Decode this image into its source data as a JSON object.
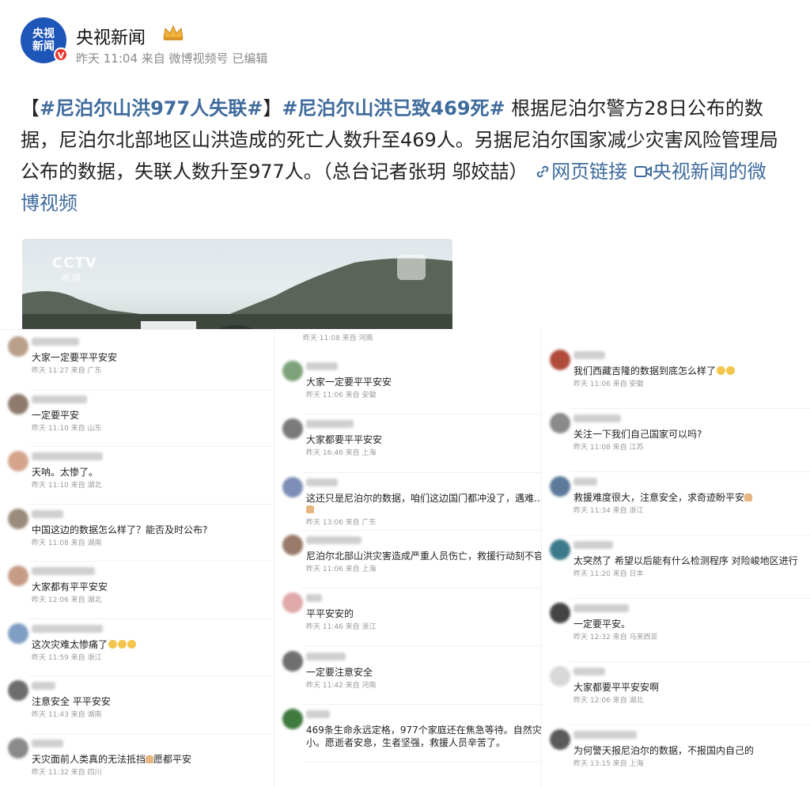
{
  "post": {
    "author": "央视新闻",
    "avatar_text_1": "央视",
    "avatar_text_2": "新闻",
    "verified_icon": "V",
    "time": "昨天 11:04",
    "source": "来自 微博视频号",
    "edited": "已编辑",
    "bracket_open": "【",
    "tag1": "#尼泊尔山洪977人失联#",
    "bracket_close": "】",
    "tag2": "#尼泊尔山洪已致469死#",
    "body": " 根据尼泊尔警方28日公布的数据，尼泊尔北部地区山洪造成的死亡人数升至469人。另据尼泊尔国家减少灾害风险管理局公布的数据，失联人数升至977人。（总台记者张玥 邬姣喆）",
    "link_web": "网页链接",
    "link_video": "央视新闻的微博视频",
    "icons": {
      "web_link": "link-icon",
      "video": "video-icon",
      "badge": "crown-badge-icon"
    }
  },
  "video": {
    "watermark": "CCTV",
    "watermark_sub": "新闻"
  },
  "columns": [
    {
      "top_time": "",
      "comments": [
        {
          "text": "大家一定要平平安安",
          "time": "昨天 11:27 来自 广东",
          "avatar": "#b8a08a"
        },
        {
          "text": "一定要平安",
          "time": "昨天 11:10 来自 山东",
          "avatar": "#8f7b6e"
        },
        {
          "text": "天呐。太惨了。",
          "time": "昨天 11:10 来自 湖北",
          "avatar": "#d4a48c"
        },
        {
          "text": "中国这边的数据怎么样了？能否及时公布?",
          "time": "昨天 11:08 来自 湖南",
          "avatar": "#9a8c7c"
        },
        {
          "text": "大家都有平平安安",
          "time": "昨天 12:06 来自 湖北",
          "avatar": "#c59c86"
        },
        {
          "text": "这次灾难太惨痛了",
          "time": "昨天 11:59 来自 浙江",
          "avatar": "#7f9ec4",
          "emoji": 3
        },
        {
          "text": "注意安全 平平安安",
          "time": "昨天 11:43 来自 湖南",
          "avatar": "#6d6d6d"
        },
        {
          "text": "天灾面前人类真的无法抵挡",
          "text_after": "愿都平安",
          "pray": true,
          "time": "昨天 11:32 来自 四川",
          "avatar": "#8a8a8a"
        }
      ]
    },
    {
      "top_time": "昨天 11:08 来自 河南",
      "comments": [
        {
          "text": "大家一定要平平安安",
          "time": "昨天 11:06 来自 安徽",
          "avatar": "#7ea37a"
        },
        {
          "text": "大家都要平平安安",
          "time": "昨天 16:46 来自 上海",
          "avatar": "#7a7a7a"
        },
        {
          "text": "这还只是尼泊尔的数据，咱们这边国门都冲没了，遇难...",
          "text2": "",
          "pray_line": true,
          "time": "昨天 13:06 来自 广东",
          "avatar": "#7d8fb8"
        },
        {
          "text": "尼泊尔北部山洪灾害造成严重人员伤亡，救援行动刻不容",
          "time": "昨天 11:06 来自 上海",
          "avatar": "#9a7b6a"
        },
        {
          "text": "平平安安的",
          "time": "昨天 11:46 来自 浙江",
          "avatar": "#e0a8a8"
        },
        {
          "text": "一定要注意安全",
          "time": "昨天 11:42 来自 河南",
          "avatar": "#6f6f6f"
        },
        {
          "text": "469条生命永远定格，977个家庭还在焦急等待。自然灾",
          "text2": "小。愿逝者安息，生者坚强，救援人员辛苦了。",
          "time": "",
          "avatar": "#3f7a3f"
        }
      ]
    },
    {
      "top_time": "",
      "comments": [
        {
          "text": "我们西藏吉隆的数据到底怎么样了",
          "emoji": 2,
          "time": "昨天 11:06 来自 安徽",
          "avatar": "#b04a3a"
        },
        {
          "text": "关注一下我们自己国家可以吗?",
          "time": "昨天 11:08 来自 江苏",
          "avatar": "#8a8a8a"
        },
        {
          "text": "救援难度很大，注意安全，求奇迹盼平安",
          "pray": true,
          "time": "昨天 11:34 来自 浙江",
          "avatar": "#5d7a9a"
        },
        {
          "text": "太突然了 希望以后能有什么检测程序 对险峻地区进行",
          "time": "昨天 11:20 来自 日本",
          "avatar": "#3a7a8a"
        },
        {
          "text": "一定要平安。",
          "time": "昨天 12:32 来自 马来西亚",
          "avatar": "#444444"
        },
        {
          "text": "大家都要平平安安啊",
          "time": "昨天 12:06 来自 湖北",
          "avatar": "#d8d8d8"
        },
        {
          "text": "为何警天报尼泊尔的数据，不报国内自己的",
          "time": "昨天 13:15 来自 上海",
          "avatar": "#5a5a5a"
        }
      ]
    }
  ]
}
